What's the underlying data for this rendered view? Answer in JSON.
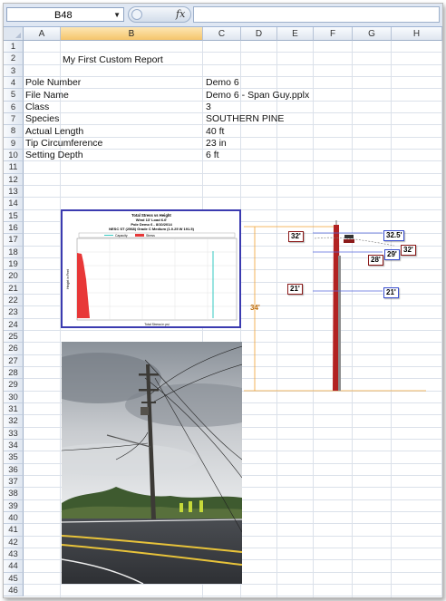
{
  "name_box": {
    "value": "B48",
    "dropdown_icon": "triangle-down-icon"
  },
  "formula_bar": {
    "fx_label": "fx",
    "value": ""
  },
  "columns": [
    "A",
    "B",
    "C",
    "D",
    "E",
    "F",
    "G",
    "H"
  ],
  "selected_column": "B",
  "rows": [
    "1",
    "2",
    "3",
    "4",
    "5",
    "6",
    "7",
    "8",
    "9",
    "10",
    "11",
    "12",
    "13",
    "14",
    "15",
    "16",
    "17",
    "18",
    "19",
    "20",
    "21",
    "22",
    "23",
    "24",
    "25",
    "26",
    "27",
    "28",
    "29",
    "30",
    "31",
    "32",
    "33",
    "34",
    "35",
    "36",
    "37",
    "38",
    "39",
    "40",
    "41",
    "42",
    "43",
    "44",
    "45",
    "46"
  ],
  "report": {
    "title": "My First Custom Report",
    "fields": [
      {
        "label": "Pole Number",
        "value": "Demo 6"
      },
      {
        "label": "File Name",
        "value": "Demo 6 - Span Guy.pplx"
      },
      {
        "label": "Class",
        "value": "3"
      },
      {
        "label": "Species",
        "value": "SOUTHERN PINE"
      },
      {
        "label": "Actual Length",
        "value": "40 ft"
      },
      {
        "label": "Tip Circumference",
        "value": "23 in"
      },
      {
        "label": "Setting Depth",
        "value": "6 ft"
      }
    ]
  },
  "chart": {
    "title_lines": [
      "Total Stress vs Height",
      "Wind 13'    Load 6.6'",
      "Pole Demo 6  -  8/10/2014",
      "NESC ST (2568) Grade C  Medium (1.0.25 W 191.5)"
    ],
    "legend": [
      "Capacity",
      "Stress"
    ],
    "xlabel": "Total Stress in psi",
    "ylabel": "Height in Feet",
    "colors": {
      "capacity": "#36c9c0",
      "stress": "#e83838"
    }
  },
  "pole_diagram": {
    "labels": [
      "32'",
      "32.5'",
      "29'",
      "32'",
      "28'",
      "21'",
      "21'",
      "34'"
    ],
    "colors": {
      "pole": "#b22222",
      "guide": "#f0a030",
      "box_border": "#8b1a1a",
      "box_border_blue": "#3a4fd0",
      "line": "#5566dd"
    }
  },
  "photo": {
    "icon": "utility-pole-photo"
  }
}
